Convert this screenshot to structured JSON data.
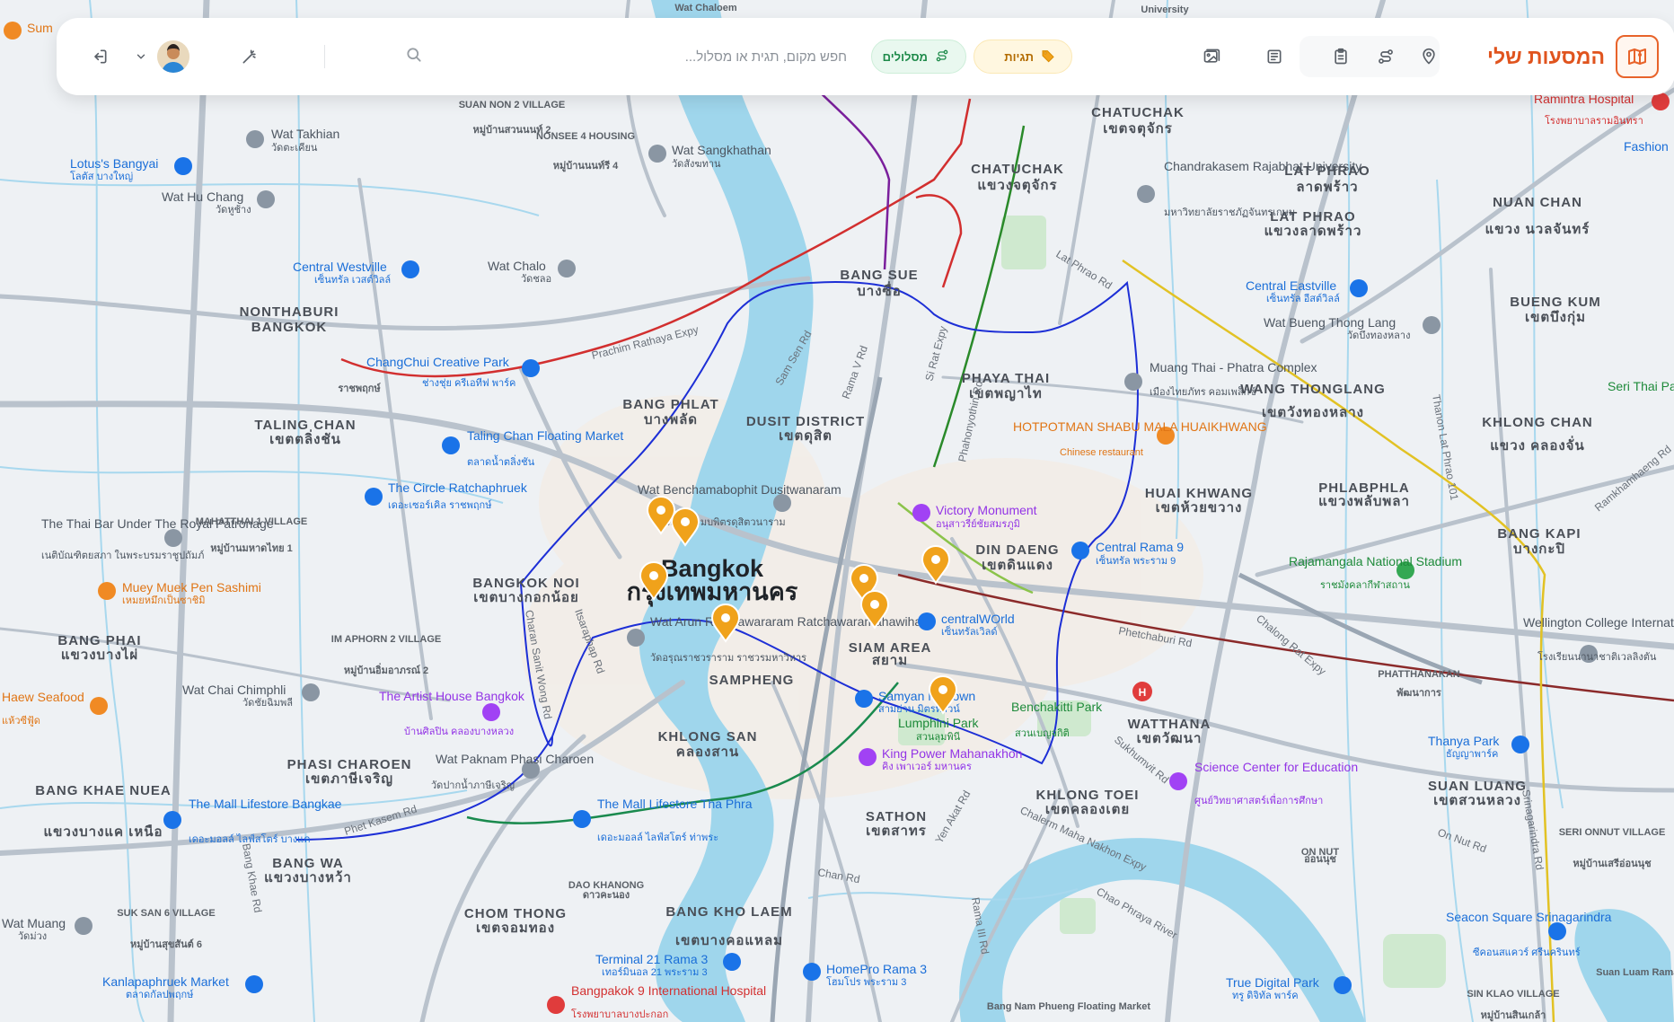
{
  "app": {
    "title": "המסעות שלי"
  },
  "toolbar": {
    "tags_label": "תגיות",
    "routes_label": "מסלולים",
    "search_placeholder": "חפש מקום, תגית או מסלול..."
  },
  "icons": {
    "brand": "map-icon",
    "location": "map-pin-icon",
    "route": "route-icon",
    "clipboard": "clipboard-icon",
    "notebook": "notebook-icon",
    "gallery": "image-gallery-icon",
    "tags": "tag-icon",
    "routes": "route-icon",
    "search": "search-icon",
    "magic": "magic-wand-icon",
    "dropdown": "chevron-down-icon",
    "logout": "logout-icon"
  },
  "colors": {
    "accent": "#e8632a",
    "tags_bg": "#fff7e0",
    "routes_bg": "#e9f8ef",
    "route_line": "#1d2fd6",
    "pin": "#f0a21b"
  },
  "map": {
    "city": {
      "en": "Bangkok",
      "th": "กรุงเทพมหานคร"
    },
    "districts": [
      {
        "en": "CHATUCHAK",
        "th": "เขตจตุจักร"
      },
      {
        "en": "CHATUCHAK",
        "th": "แขวงจตุจักร"
      },
      {
        "en": "LAT PHRAO",
        "th": "ลาดพร้าว"
      },
      {
        "en": "LAT PHRAO",
        "th": "แขวงลาดพร้าว"
      },
      {
        "en": "NUAN CHAN",
        "th": "แขวง นวลจันทร์"
      },
      {
        "en": "BUENG KUM",
        "th": "เขตบึงกุ่ม"
      },
      {
        "en": "BANG SUE",
        "th": "บางซื่อ"
      },
      {
        "en": "PHAYA THAI",
        "th": "เขตพญาไท"
      },
      {
        "en": "WANG THONGLANG",
        "th": "เขตวังทองหลาง"
      },
      {
        "en": "KHLONG CHAN",
        "th": "แขวง คลองจั่น"
      },
      {
        "en": "BANG PHLAT",
        "th": "บางพลัด"
      },
      {
        "en": "DUSIT DISTRICT",
        "th": "เขตดุสิต"
      },
      {
        "en": "HUAI KHWANG",
        "th": "เขตห้วยขวาง"
      },
      {
        "en": "PHLABPHLA",
        "th": "แขวงพลับพลา"
      },
      {
        "en": "TALING CHAN",
        "th": "เขตตลิ่งชัน"
      },
      {
        "en": "DIN DAENG",
        "th": "เขตดินแดง"
      },
      {
        "en": "BANG KAPI",
        "th": "บางกะปิ"
      },
      {
        "en": "BANGKOK NOI",
        "th": "เขตบางกอกน้อย"
      },
      {
        "en": "BANG PHAI",
        "th": "แขวงบางไผ่"
      },
      {
        "en": "SIAM AREA",
        "th": "สยาม"
      },
      {
        "en": "SAMPHENG",
        "th": ""
      },
      {
        "en": "KHLONG SAN",
        "th": "คลองสาน"
      },
      {
        "en": "WATTHANA",
        "th": "เขตวัฒนา"
      },
      {
        "en": "PHASI CHAROEN",
        "th": "เขตภาษีเจริญ"
      },
      {
        "en": "KHLONG TOEI",
        "th": "เขตคลองเตย"
      },
      {
        "en": "SUAN LUANG",
        "th": "เขตสวนหลวง"
      },
      {
        "en": "BANG KHAE NUEA",
        "th": "แขวงบางแค เหนือ"
      },
      {
        "en": "SATHON",
        "th": "เขตสาทร"
      },
      {
        "en": "BANG WA",
        "th": "แขวงบางหว้า"
      },
      {
        "en": "CHOM THONG",
        "th": "เขตจอมทอง"
      },
      {
        "en": "BANG KHO LAEM",
        "th": "เขตบางคอแหลม"
      },
      {
        "en": "NONTHABURI",
        "th": "BANGKOK"
      }
    ],
    "pois": [
      {
        "name": "Wat Takhian",
        "sub": "วัดตะเคียน"
      },
      {
        "name": "Lotus's Bangyai",
        "sub": "โลตัส บางใหญ่"
      },
      {
        "name": "Wat Hu Chang",
        "sub": "วัดหูช้าง"
      },
      {
        "name": "Wat Sangkhathan",
        "sub": "วัดสังฆทาน"
      },
      {
        "name": "Chandrakasem Rajabhat University",
        "sub": "มหาวิทยาลัยราชภัฏจันทรเกษม"
      },
      {
        "name": "Central Westville",
        "sub": "เซ็นทรัล เวสต์วิลล์"
      },
      {
        "name": "Wat Chalo",
        "sub": "วัดชลอ"
      },
      {
        "name": "Central Eastville",
        "sub": "เซ็นทรัล อีสต์วิลล์"
      },
      {
        "name": "Wat Bueng Thong Lang",
        "sub": "วัดบึงทองหลาง"
      },
      {
        "name": "ChangChui Creative Park",
        "sub": "ช่างชุ่ย ครีเอทีฟ พาร์ค"
      },
      {
        "name": "Muang Thai - Phatra Complex",
        "sub": "เมืองไทยภัทร คอมเพล็กซ์"
      },
      {
        "name": "HOTPOTMAN SHABU MALA HUAIKHWANG",
        "sub": "Chinese restaurant"
      },
      {
        "name": "Taling Chan Floating Market",
        "sub": "ตลาดน้ำตลิ่งชัน"
      },
      {
        "name": "Wat Benchamabophit Dusitwanaram",
        "sub": "วัดเบญจมบพิตรดุสิตวนาราม"
      },
      {
        "name": "Victory Monument",
        "sub": "อนุสาวรีย์ชัยสมรภูมิ"
      },
      {
        "name": "The Circle Ratchaphruek",
        "sub": "เดอะเซอร์เคิล ราชพฤกษ์"
      },
      {
        "name": "Central Rama 9",
        "sub": "เซ็นทรัล พระราม 9"
      },
      {
        "name": "Rajamangala National Stadium",
        "sub": "ราชมังคลากีฬาสถาน"
      },
      {
        "name": "The Thai Bar Under The Royal Patronage",
        "sub": "เนติบัณฑิตยสภา ในพระบรมราชูปถัมภ์"
      },
      {
        "name": "Muey Muek Pen Sashimi",
        "sub": "เหมยหมึกเป็นซาชิมิ"
      },
      {
        "name": "Wat Arun Ratchawararam Ratchawaramahawihan",
        "sub": "วัดอรุณราชวราราม ราชวรมหาวิหาร"
      },
      {
        "name": "centralWOrld",
        "sub": "เซ็นทรัลเวิลด์"
      },
      {
        "name": "Wellington College International School",
        "sub": "โรงเรียนนานาชาติเวลลิงตัน"
      },
      {
        "name": "Samyan Mitrtown",
        "sub": "สามย่าน มิตรทาวน์"
      },
      {
        "name": "Lumphini Park",
        "sub": "สวนลุมพินี"
      },
      {
        "name": "Benchakitti Park",
        "sub": "สวนเบญจกิติ"
      },
      {
        "name": "The Artist House Bangkok",
        "sub": "บ้านศิลปิน คลองบางหลวง"
      },
      {
        "name": "Haew Seafood",
        "sub": "แห้วซีฟู้ด"
      },
      {
        "name": "Wat Chai Chimphli",
        "sub": "วัดชัยฉิมพลี"
      },
      {
        "name": "King Power Mahanakhon",
        "sub": "คิง เพาเวอร์ มหานคร"
      },
      {
        "name": "Wat Paknam Phasi Charoen",
        "sub": "วัดปากน้ำภาษีเจริญ"
      },
      {
        "name": "Thanya Park",
        "sub": "ธัญญาพาร์ค"
      },
      {
        "name": "Science Center for Education",
        "sub": "ศูนย์วิทยาศาสตร์เพื่อการศึกษา"
      },
      {
        "name": "The Mall Lifestore Bangkae",
        "sub": "เดอะมอลล์ ไลฟ์สโตร์ บางแค"
      },
      {
        "name": "The Mall Lifestore Tha Phra",
        "sub": "เดอะมอลล์ ไลฟ์สโตร์ ท่าพระ"
      },
      {
        "name": "Seacon Square Srinagarindra",
        "sub": "ซีคอนสแควร์ ศรีนครินทร์"
      },
      {
        "name": "Wat Muang",
        "sub": "วัดม่วง"
      },
      {
        "name": "Kanlapaphruek Market",
        "sub": "ตลาดกัลปพฤกษ์"
      },
      {
        "name": "Terminal 21 Rama 3",
        "sub": "เทอร์มินอล 21 พระราม 3"
      },
      {
        "name": "HomePro Rama 3",
        "sub": "โฮมโปร พระราม 3"
      },
      {
        "name": "True Digital Park",
        "sub": "ทรู ดิจิทัล พาร์ค"
      },
      {
        "name": "Bangpakok 9 International Hospital",
        "sub": "โรงพยาบาลบางปะกอก"
      },
      {
        "name": "Ramintra Hospital",
        "sub": "โรงพยาบาลรามอินทรา"
      },
      {
        "name": "Seri Thai Pa",
        "sub": ""
      },
      {
        "name": "Fashion",
        "sub": ""
      },
      {
        "name": "Sum",
        "sub": ""
      }
    ],
    "roads": [
      "Prachim Rathaya Expy",
      "Lat Phrao Rd",
      "Sam Sen Rd",
      "Rama V Rd",
      "Si Rat Expy",
      "Phahonyothin Rd",
      "Charan Sanit Wong Rd",
      "Itsaraphap Rd",
      "Phet Kasem Rd",
      "Phetchaburi Rd",
      "Sukhumvit Rd",
      "Chan Rd",
      "Yen Akat Rd",
      "Chalerm Maha Nakhon Expy",
      "Rama III Rd",
      "Chao Phraya River",
      "Thanon Lat Phrao 101",
      "Ramkhamhaeng Rd",
      "On Nut Rd",
      "Srinagarindra Rd",
      "Chalong Rat Expy",
      "Bang Khae Rd",
      "Chalerm Maha Nakhon Expy"
    ],
    "villages": [
      {
        "en": "SUAN NON 2 VILLAGE",
        "th": "หมู่บ้านสวนนนท์ 2"
      },
      {
        "en": "NONSEE 4 HOUSING",
        "th": "หมู่บ้านนนท์รี 4"
      },
      {
        "en": "MAHATTHAI 1 VILLAGE",
        "th": "หมู่บ้านมหาดไทย 1"
      },
      {
        "en": "IM APHORN 2 VILLAGE",
        "th": "หมู่บ้านอิ่มอาภรณ์ 2"
      },
      {
        "en": "SUK SAN 6 VILLAGE",
        "th": "หมู่บ้านสุขสันต์ 6"
      },
      {
        "en": "DAO KHANONG",
        "th": "ดาวคะนอง"
      },
      {
        "en": "PHATTHANAKAN",
        "th": "พัฒนาการ"
      },
      {
        "en": "SERI ONNUT VILLAGE",
        "th": "หมู่บ้านเสรีอ่อนนุช"
      },
      {
        "en": "SIN KLAO VILLAGE",
        "th": "หมู่บ้านสินเกล้า"
      },
      {
        "en": "Suan Luam Rama IX",
        "th": ""
      },
      {
        "en": "Bang Nam Phueng Floating Market",
        "th": ""
      },
      {
        "en": "ON NUT",
        "th": "อ่อนนุช"
      },
      {
        "en": "ราชพฤกษ์",
        "th": ""
      },
      {
        "en": "University",
        "th": ""
      },
      {
        "en": "Wat Chaloem",
        "th": ""
      }
    ],
    "pins_count": 8
  }
}
